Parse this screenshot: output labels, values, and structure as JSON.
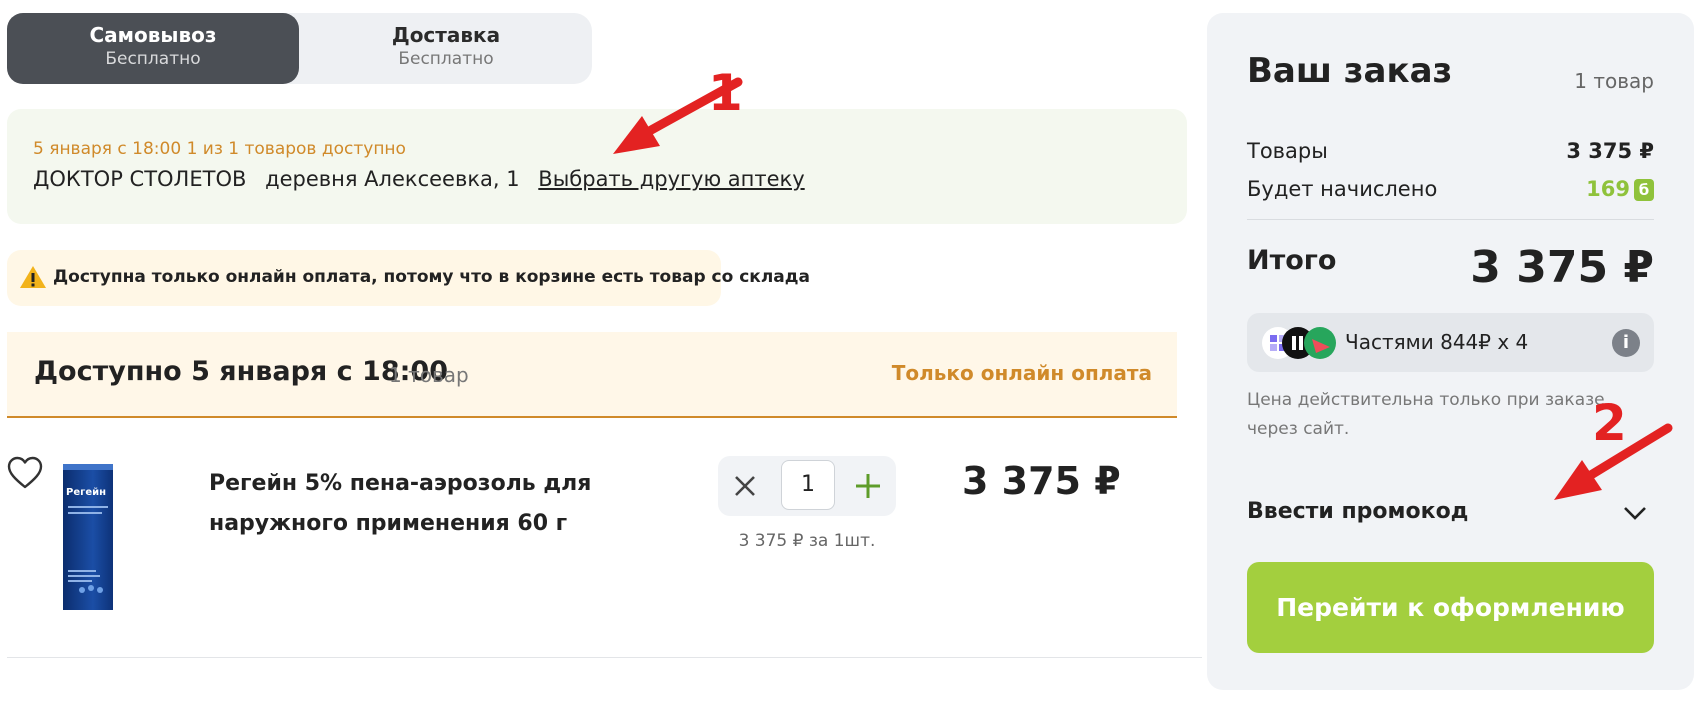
{
  "delivery_toggle": {
    "pickup": {
      "title": "Самовывоз",
      "subtitle": "Бесплатно"
    },
    "delivery": {
      "title": "Доставка",
      "subtitle": "Бесплатно"
    }
  },
  "pharmacy": {
    "availability": "5 января с 18:00 1 из 1 товаров доступно",
    "name": "ДОКТОР СТОЛЕТОВ",
    "address": "деревня Алексеевка, 1",
    "change_link": "Выбрать другую аптеку"
  },
  "warning": {
    "icon": "warning-icon",
    "text": "Доступна только онлайн оплата, потому что в корзине есть товар со склада"
  },
  "group": {
    "title": "Доступно 5 января с 18:00",
    "count": "1 товар",
    "payment": "Только онлайн оплата"
  },
  "product": {
    "name": "Регейн 5% пена-аэрозоль для наружного применения 60 г",
    "image_label": "Регейн",
    "quantity": "1",
    "unit_price": "3 375 ₽ за 1шт.",
    "price": "3 375 ₽"
  },
  "summary": {
    "title": "Ваш заказ",
    "count": "1 товар",
    "goods_label": "Товары",
    "goods_value": "3 375 ₽",
    "bonus_label": "Будет начислено",
    "bonus_value": "169",
    "bonus_badge": "б",
    "total_label": "Итого",
    "total_value": "3 375 ₽",
    "bnpl_text": "Частями 844₽ х 4",
    "bnpl_info": "i",
    "note": "Цена действительна только при заказе через сайт.",
    "promo_label": "Ввести промокод",
    "checkout_label": "Перейти к оформлению"
  },
  "annotations": {
    "one": "1",
    "two": "2"
  },
  "colors": {
    "accent_green": "#a3cf3e",
    "orange": "#d08a2a",
    "dark_toggle": "#4b4f55",
    "annotation_red": "#e32222"
  }
}
